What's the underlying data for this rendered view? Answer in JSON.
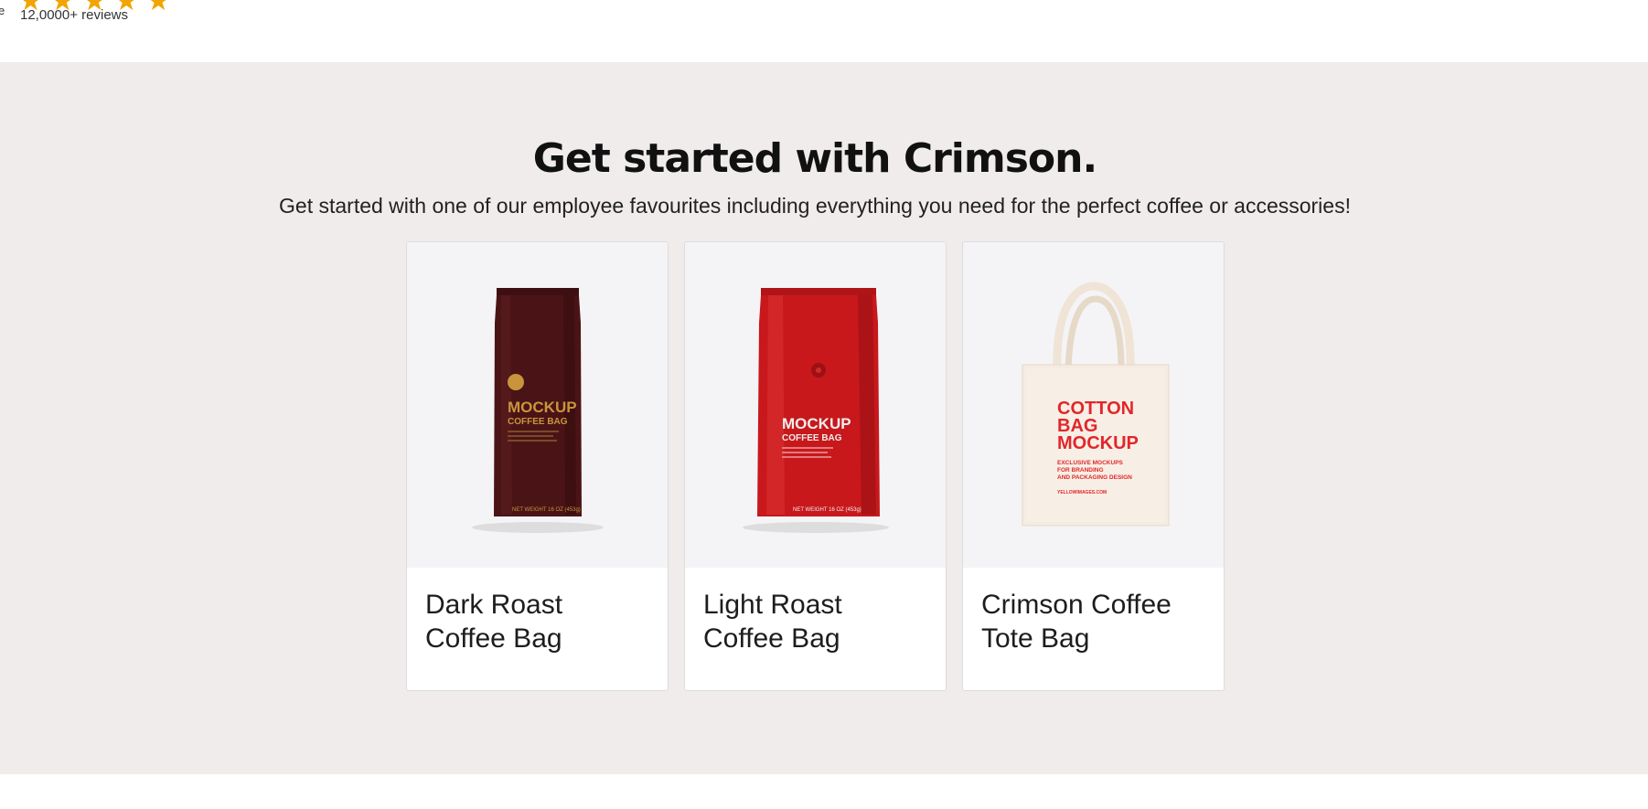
{
  "reviews": {
    "left_fragment": "e",
    "stars": [
      "★",
      "★",
      "★",
      "★",
      "★"
    ],
    "count_text": "12,0000+ reviews"
  },
  "section": {
    "heading": "Get started with Crimson.",
    "subheading": "Get started with one of our employee favourites including everything you need for the perfect coffee or accessories!"
  },
  "cards": [
    {
      "title": "Dark Roast Coffee Bag",
      "image": {
        "brand": "MOCKUP",
        "sub": "COFFEE BAG",
        "weight": "NET WEIGHT 16 OZ (453g)",
        "color": "#4a1416"
      }
    },
    {
      "title": "Light Roast Coffee Bag",
      "image": {
        "brand": "MOCKUP",
        "sub": "COFFEE BAG",
        "weight": "NET WEIGHT 16 OZ (453g)",
        "color": "#c8181c"
      }
    },
    {
      "title": "Crimson Coffee Tote Bag",
      "image": {
        "line1": "COTTON",
        "line2": "BAG",
        "line3": "MOCKUP",
        "small1": "EXCLUSIVE MOCKUPS",
        "small2": "FOR BRANDING",
        "small3": "AND PACKAGING DESIGN",
        "site": "YELLOWIMAGES.COM",
        "color": "#f5ece1"
      }
    }
  ]
}
